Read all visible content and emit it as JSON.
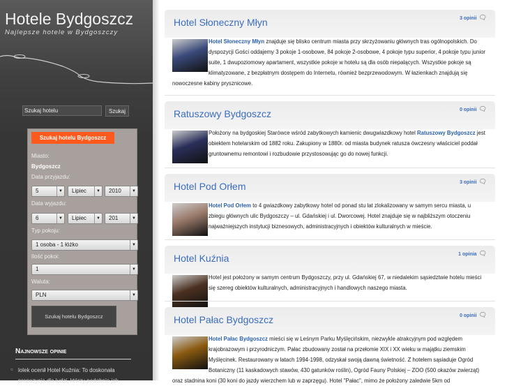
{
  "site": {
    "title": "Hotele Bydgoszcz",
    "subtitle": "Najlepsze hotele w Bydgoszczy"
  },
  "search": {
    "value": "Szukaj hotelu",
    "button": "Szukaj"
  },
  "form": {
    "header_button": "Szukaj hotelu Bydgoszcz",
    "city_label": "Miasto:",
    "city": "Bydgoszcz",
    "arrival_label": "Data przyjazdu:",
    "arrival": {
      "day": "5",
      "month": "Lipiec",
      "year": "2010"
    },
    "departure_label": "Data wyjazdu:",
    "departure": {
      "day": "6",
      "month": "Lipiec",
      "year": "201"
    },
    "room_type_label": "Typ pokoju:",
    "room_type": "1 osoba - 1 łóżko",
    "rooms_label": "Ilość pokoi:",
    "rooms": "1",
    "currency_label": "Waluta:",
    "currency": "PLN",
    "submit": "Szukaj hotelu Bydgoszcz"
  },
  "reviews": {
    "heading": "Najnowsze opinie",
    "items": [
      "lolek ocenił Hotel Kuźnia: To doskonała propozycja dla ludzi, którzy podobnie jak"
    ]
  },
  "posts": [
    {
      "title": "Hotel Słoneczny Młyn",
      "comments": "3 opinii",
      "link": "Hotel Słoneczny Młyn",
      "text": " znajduje się blisko centrum miasta przy skrzyżowaniu głównych tras ogólnopolskich. Do dyspozycji Gości oddajemy 3 pokoje 1-osobowe, 84 pokoje 2-osobowe, 4 pokoje typu superior, 4 pokoje typu junior suite, 1 dwupoziomowy apartament, wszystkie pokoje w hotelu są dla osób niepalących. Wszystkie pokoje są klimatyzowane, z bezpłatnym dostępem do Internetu, również bezprzewodowym. W łazienkach znajdują się nowoczesne kabiny prysznicowe.",
      "thumb": "#3a4a7a"
    },
    {
      "title": "Ratuszowy Bydgoszcz",
      "comments": "0 opinii",
      "text_before": "Położony na bydgoskiej Starówce wśród zabytkowych kamienic dwugwiazdkowy hotel ",
      "link": "Ratuszowy Bydgoszcz",
      "text": " jest obiektem hotelarskim od 1882 roku. Zakupiony w 1880r. od miasta budynek ratusza ówczesny właściciel poddał gruntownemu remontowi i rozbudowie przystosowując go do nowej funkcji.",
      "thumb": "#2a2f5a"
    },
    {
      "title": "Hotel Pod Orłem",
      "comments": "3 opinii",
      "link": "Hotel Pod Orłem",
      "text": " to 4 gwiazdkowy zabytkowy hotel od ponad stu lat zlokalizowany w samym sercu miasta, u zbiegu głównych ulic Bydgoszczy – ul. Gdańskiej i ul. Dworcowej. Hotel znajduje się w najbliższym otoczeniu najważniejszych instytucji biznesowych, administracyjnych i obiektów kulturalnych w mieście.",
      "thumb": "#9a7a6a"
    },
    {
      "title": "Hotel Kuźnia",
      "comments": "1 opinia",
      "text": "Hotel jest położony w samym centrum Bydgoszczy, przy ul. Gdańskiej 67, w niedalekim sąsiedztwie hotelu mieści się szereg obiektów kulturalnych, administracyjnych i handlowych naszego miasta.",
      "thumb": "#4a3020"
    },
    {
      "title": "Hotel Pałac Bydgoszcz",
      "comments": "0 opinii",
      "link": "Hotel Pałac Bydgoszcz",
      "text": " mieści się w Leśnym Parku Myślęcińskim, niezwykle atrakcyjnym pod względem krajobrazowym i przyrodniczym. Pałac zbudowany został na przełomie XIX i XX wieku w majątku ziemskim Myślęcinek. Restaurowany w latach 1994-1998, odzyskał swoją dawną świetność. Z hotelem sąsiaduje Ogród Botaniczny (11 kaskadowych stawów, 430 gatunków roślin), Ogród Fauny Polskiej – ZOO (500 okazów zwierząt) oraz stadnina koni (30 koni do jazdy wierzchem lub w zaprzęgu). Hotel \"Pałac\", mimo że położony zaledwie 5km od",
      "thumb": "#8a5a10"
    }
  ]
}
